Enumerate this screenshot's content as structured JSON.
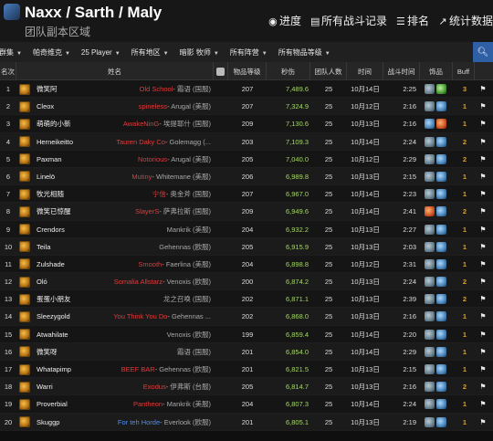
{
  "header": {
    "title": "Naxx / Sarth / Maly",
    "subtitle": "团队副本区域",
    "nav": [
      {
        "icon": "globe-icon",
        "glyph": "◉",
        "label": "进度"
      },
      {
        "icon": "list-icon",
        "glyph": "▤",
        "label": "所有战斗记录"
      },
      {
        "icon": "ranking-icon",
        "glyph": "☰",
        "label": "排名"
      },
      {
        "icon": "stats-icon",
        "glyph": "↗",
        "label": "统计数据"
      }
    ]
  },
  "filters": [
    {
      "label": "群集"
    },
    {
      "label": "帕奇维克"
    },
    {
      "label": "25 Player"
    },
    {
      "label": "所有地区"
    },
    {
      "label": "暗影 牧师"
    },
    {
      "label": "所有阵营"
    },
    {
      "label": "所有物品等级"
    }
  ],
  "table": {
    "headers": {
      "rank": "名次",
      "name": "姓名",
      "video": "",
      "ilvl": "物品等级",
      "dps": "秒伤",
      "size": "团队人数",
      "date": "时间",
      "duration": "战斗时间",
      "items": "饰品",
      "buff": "Buff",
      "flag": ""
    },
    "rows": [
      {
        "rank": "1",
        "name": "微笑阿",
        "guild": "Old School",
        "guild_color": "red",
        "server": "- 霜语 (国服)",
        "ilvl": "207",
        "dps": "7,489.6",
        "size": "25",
        "date": "10月14日",
        "duration": "2:25",
        "items": [
          "it",
          "g"
        ],
        "buff": "3"
      },
      {
        "rank": "2",
        "name": "Cleox",
        "guild": "spineless",
        "guild_color": "red",
        "server": "- Arugal (美服)",
        "ilvl": "207",
        "dps": "7,324.9",
        "size": "25",
        "date": "10月12日",
        "duration": "2:16",
        "items": [
          "it",
          "b"
        ],
        "buff": "1"
      },
      {
        "rank": "3",
        "name": "萌萌的小新",
        "guild": "AwakeNinG",
        "guild_color": "red",
        "server": "- 埃提耶什 (国服)",
        "ilvl": "209",
        "dps": "7,130.6",
        "size": "25",
        "date": "10月13日",
        "duration": "2:16",
        "items": [
          "b",
          "r"
        ],
        "buff": "1"
      },
      {
        "rank": "4",
        "name": "Herneikeitto",
        "guild": "Tauren Daky Co",
        "guild_color": "red",
        "server": "- Golemagg (...",
        "ilvl": "203",
        "dps": "7,109.3",
        "size": "25",
        "date": "10月14日",
        "duration": "2:24",
        "items": [
          "it",
          "b"
        ],
        "buff": "2"
      },
      {
        "rank": "5",
        "name": "Paxman",
        "guild": "Notorious",
        "guild_color": "red",
        "server": "- Arugal (美服)",
        "ilvl": "205",
        "dps": "7,040.0",
        "size": "25",
        "date": "10月12日",
        "duration": "2:29",
        "items": [
          "it",
          "b"
        ],
        "buff": "2"
      },
      {
        "rank": "6",
        "name": "Linelö",
        "guild": "Mutiny",
        "guild_color": "red",
        "server": "- Whitemane (美服)",
        "ilvl": "206",
        "dps": "6,989.8",
        "size": "25",
        "date": "10月13日",
        "duration": "2:15",
        "items": [
          "it",
          "b"
        ],
        "buff": "1"
      },
      {
        "rank": "7",
        "name": "牧光相随",
        "guild": "宁信",
        "guild_color": "red",
        "server": "- 奥金斧 (国服)",
        "ilvl": "207",
        "dps": "6,967.0",
        "size": "25",
        "date": "10月14日",
        "duration": "2:23",
        "items": [
          "it",
          "b"
        ],
        "buff": "1"
      },
      {
        "rank": "8",
        "name": "微笑已惊醒",
        "guild": "SlayerS",
        "guild_color": "red",
        "server": "- 萨弗拉斯 (国服)",
        "ilvl": "209",
        "dps": "6,949.6",
        "size": "25",
        "date": "10月14日",
        "duration": "2:41",
        "items": [
          "r",
          "b"
        ],
        "buff": "2"
      },
      {
        "rank": "9",
        "name": "Crendors",
        "guild": "",
        "guild_color": "white",
        "server": "Mankrik (美服)",
        "ilvl": "204",
        "dps": "6,932.2",
        "size": "25",
        "date": "10月13日",
        "duration": "2:27",
        "items": [
          "it",
          "b"
        ],
        "buff": "1"
      },
      {
        "rank": "10",
        "name": "Teila",
        "guild": "",
        "guild_color": "white",
        "server": "Gehennas (欧服)",
        "ilvl": "205",
        "dps": "6,915.9",
        "size": "25",
        "date": "10月13日",
        "duration": "2:03",
        "items": [
          "it",
          "b"
        ],
        "buff": "1"
      },
      {
        "rank": "11",
        "name": "Zulshade",
        "guild": "Smooth",
        "guild_color": "red",
        "server": "- Faerlina (美服)",
        "ilvl": "204",
        "dps": "6,898.8",
        "size": "25",
        "date": "10月12日",
        "duration": "2:31",
        "items": [
          "it",
          "b"
        ],
        "buff": "1"
      },
      {
        "rank": "12",
        "name": "Oló",
        "guild": "Somalia Allstarz",
        "guild_color": "red",
        "server": "- Venoxis (欧服)",
        "ilvl": "200",
        "dps": "6,874.2",
        "size": "25",
        "date": "10月13日",
        "duration": "2:24",
        "items": [
          "it",
          "b"
        ],
        "buff": "2"
      },
      {
        "rank": "13",
        "name": "蛋蛋小朋友",
        "guild": "",
        "guild_color": "white",
        "server": "龙之召唤 (国服)",
        "ilvl": "202",
        "dps": "6,871.1",
        "size": "25",
        "date": "10月13日",
        "duration": "2:39",
        "items": [
          "it",
          "b"
        ],
        "buff": "2"
      },
      {
        "rank": "14",
        "name": "Sleezygold",
        "guild": "You Think You Do",
        "guild_color": "red",
        "server": "- Gehennas ...",
        "ilvl": "202",
        "dps": "6,868.0",
        "size": "25",
        "date": "10月13日",
        "duration": "2:16",
        "items": [
          "it",
          "b"
        ],
        "buff": "1"
      },
      {
        "rank": "15",
        "name": "Atwahilate",
        "guild": "",
        "guild_color": "white",
        "server": "Venoxis (欧服)",
        "ilvl": "199",
        "dps": "6,859.4",
        "size": "25",
        "date": "10月14日",
        "duration": "2:20",
        "items": [
          "it",
          "b"
        ],
        "buff": "1"
      },
      {
        "rank": "16",
        "name": "微笑呀",
        "guild": "",
        "guild_color": "white",
        "server": "霜语 (国服)",
        "ilvl": "201",
        "dps": "6,854.0",
        "size": "25",
        "date": "10月14日",
        "duration": "2:29",
        "items": [
          "it",
          "b"
        ],
        "buff": "1"
      },
      {
        "rank": "17",
        "name": "Whatapimp",
        "guild": "BEEF BAR",
        "guild_color": "red",
        "server": "- Gehennas (欧服)",
        "ilvl": "201",
        "dps": "6,821.5",
        "size": "25",
        "date": "10月13日",
        "duration": "2:15",
        "items": [
          "it",
          "b"
        ],
        "buff": "1"
      },
      {
        "rank": "18",
        "name": "Warri",
        "guild": "Exodus",
        "guild_color": "red",
        "server": "- 伊弗斯 (台服)",
        "ilvl": "205",
        "dps": "6,814.7",
        "size": "25",
        "date": "10月13日",
        "duration": "2:16",
        "items": [
          "it",
          "b"
        ],
        "buff": "2"
      },
      {
        "rank": "19",
        "name": "Proverbial",
        "guild": "Pantheon",
        "guild_color": "red",
        "server": "- Mankrik (美服)",
        "ilvl": "204",
        "dps": "6,807.3",
        "size": "25",
        "date": "10月14日",
        "duration": "2:24",
        "items": [
          "it",
          "b"
        ],
        "buff": "1"
      },
      {
        "rank": "20",
        "name": "Skuggp",
        "guild": "For teh Horde",
        "guild_color": "blue",
        "server": "- Everlook (欧服)",
        "ilvl": "201",
        "dps": "6,805.1",
        "size": "25",
        "date": "10月13日",
        "duration": "2:19",
        "items": [
          "it",
          "b"
        ],
        "buff": "1"
      }
    ]
  },
  "colors": {
    "dps": "#a6d66a",
    "guild_red": "#e03b3b",
    "guild_blue": "#4e8ef0",
    "buff": "#e0a020",
    "search_button": "#2f5fa5"
  }
}
